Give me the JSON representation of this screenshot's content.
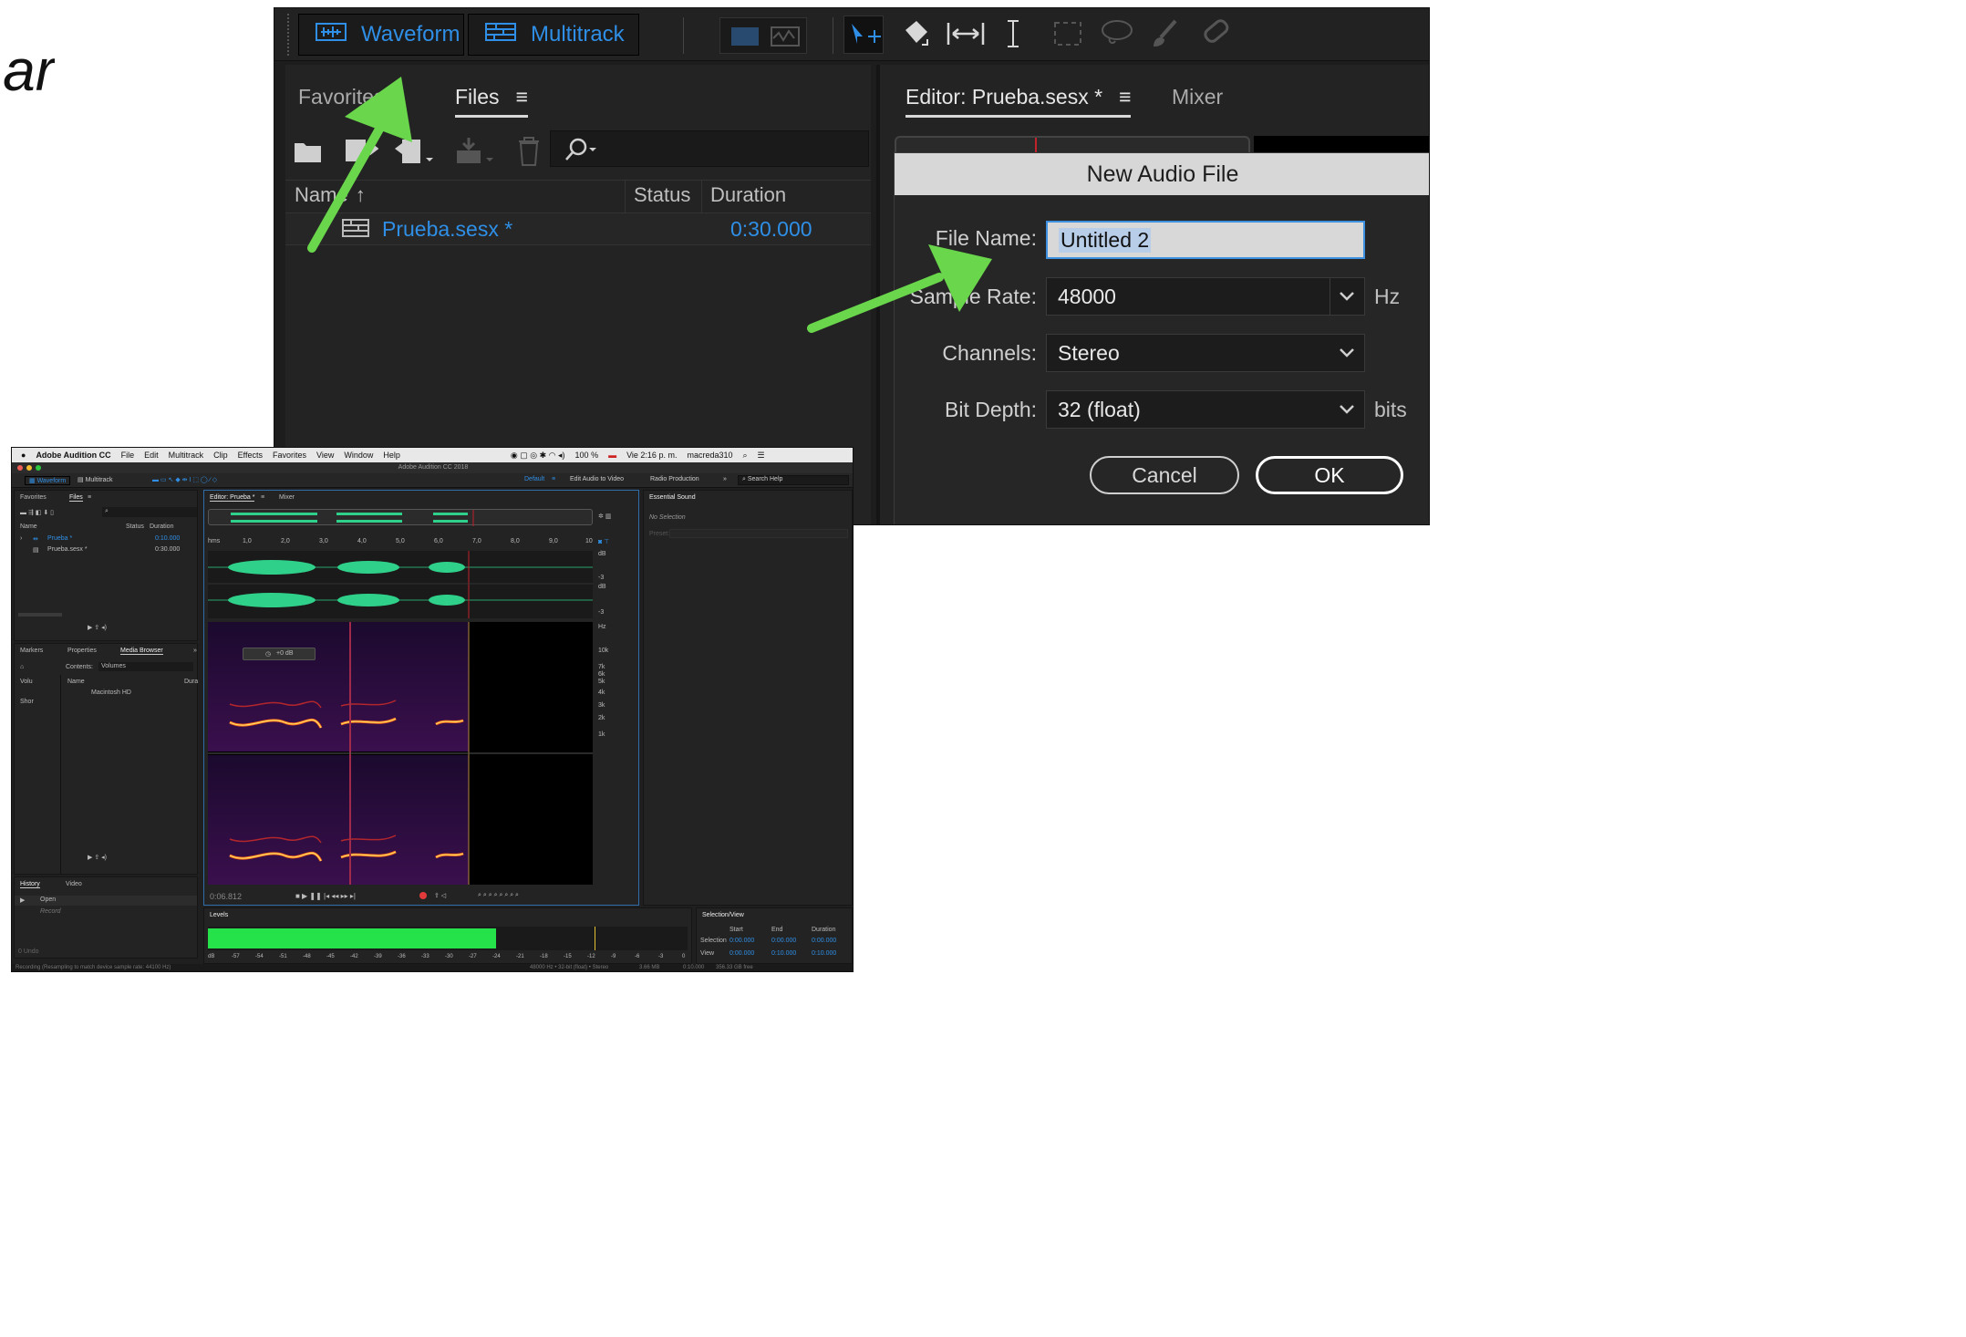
{
  "slide": {
    "partial_word": "ar"
  },
  "zoom": {
    "toolbar": {
      "waveform_label": "Waveform",
      "multitrack_label": "Multitrack"
    },
    "files_panel": {
      "tab_favorites": "Favorites",
      "tab_files": "Files",
      "col_name": "Name",
      "col_status": "Status",
      "col_duration": "Duration",
      "row_name": "Prueba.sesx *",
      "row_duration": "0:30.000"
    },
    "editor": {
      "tab_editor": "Editor: Prueba.sesx *",
      "tab_mixer": "Mixer"
    },
    "dialog": {
      "title": "New Audio File",
      "file_name_label": "File Name:",
      "file_name_value": "Untitled 2",
      "sample_rate_label": "Sample Rate:",
      "sample_rate_value": "48000",
      "sample_rate_unit": "Hz",
      "channels_label": "Channels:",
      "channels_value": "Stereo",
      "bit_depth_label": "Bit Depth:",
      "bit_depth_value": "32 (float)",
      "bit_depth_unit": "bits",
      "cancel_label": "Cancel",
      "ok_label": "OK"
    }
  },
  "app": {
    "menubar": {
      "app_name": "Adobe Audition CC",
      "items": [
        "File",
        "Edit",
        "Multitrack",
        "Clip",
        "Effects",
        "Favorites",
        "View",
        "Window",
        "Help"
      ],
      "battery": "100 %",
      "clock": "Vie 2:16 p. m.",
      "user": "macreda310"
    },
    "window_title": "Adobe Audition CC 2018",
    "toolbar": {
      "waveform": "Waveform",
      "multitrack": "Multitrack",
      "ws_default": "Default",
      "ws_edit_video": "Edit Audio to Video",
      "ws_radio": "Radio Production",
      "search_help": "Search Help"
    },
    "files": {
      "tab_favorites": "Favorites",
      "tab_files": "Files",
      "col_name": "Name",
      "col_status": "Status",
      "col_duration": "Duration",
      "rows": [
        {
          "name": "Prueba *",
          "duration": "0:10.000"
        },
        {
          "name": "Prueba.sesx *",
          "duration": "0:30.000"
        }
      ]
    },
    "media": {
      "tab_markers": "Markers",
      "tab_properties": "Properties",
      "tab_media": "Media Browser",
      "contents_label": "Contents:",
      "contents_value": "Volumes",
      "col_name": "Name",
      "col_dur": "Dura",
      "tree_volumes": "Volu",
      "tree_shortcuts": "Shor",
      "item_hd": "Macintosh HD"
    },
    "history": {
      "tab_history": "History",
      "tab_video": "Video",
      "item_open": "Open",
      "item_record": "Record",
      "undo_count": "0 Undo"
    },
    "editor": {
      "tab_editor": "Editor: Prueba *",
      "tab_mixer": "Mixer",
      "ruler": [
        "hms",
        "1,0",
        "2,0",
        "3,0",
        "4,0",
        "5,0",
        "6,0",
        "7,0",
        "8,0",
        "9,0",
        "10"
      ],
      "db_labels": [
        "dB",
        "-3",
        "dB",
        "-3"
      ],
      "hz_labels": [
        "Hz",
        "10k",
        "7k",
        "6k",
        "5k",
        "4k",
        "3k",
        "2k",
        "1k"
      ],
      "time": "0:06.812",
      "gain_hud": "+0 dB"
    },
    "essential": {
      "title": "Essential Sound",
      "no_selection": "No Selection",
      "preset": "Preset:"
    },
    "levels": {
      "title": "Levels",
      "ticks": [
        "dB",
        "-57",
        "-54",
        "-51",
        "-48",
        "-45",
        "-42",
        "-39",
        "-36",
        "-33",
        "-30",
        "-27",
        "-24",
        "-21",
        "-18",
        "-15",
        "-12",
        "-9",
        "-6",
        "-3",
        "0"
      ],
      "level_fraction": 0.6
    },
    "selection_view": {
      "title": "Selection/View",
      "headers": [
        "Start",
        "End",
        "Duration"
      ],
      "rows": [
        {
          "label": "Selection",
          "start": "0:00.000",
          "end": "0:00.000",
          "duration": "0:00.000"
        },
        {
          "label": "View",
          "start": "0:00.000",
          "end": "0:10.000",
          "duration": "0:10.000"
        }
      ]
    },
    "status": {
      "left": "Recording (Resampling to match device sample rate: 44100 Hz)",
      "right": "48000 Hz • 32-bit (float) • Stereo",
      "size": "3.66 MB",
      "dur": "0:10.000",
      "free": "356.33 GB free"
    }
  },
  "colors": {
    "accent_blue": "#2f8fe6",
    "arrow_green": "#6ad64c",
    "waveform_green": "#2fd08a",
    "meter_green": "#26e24a"
  }
}
